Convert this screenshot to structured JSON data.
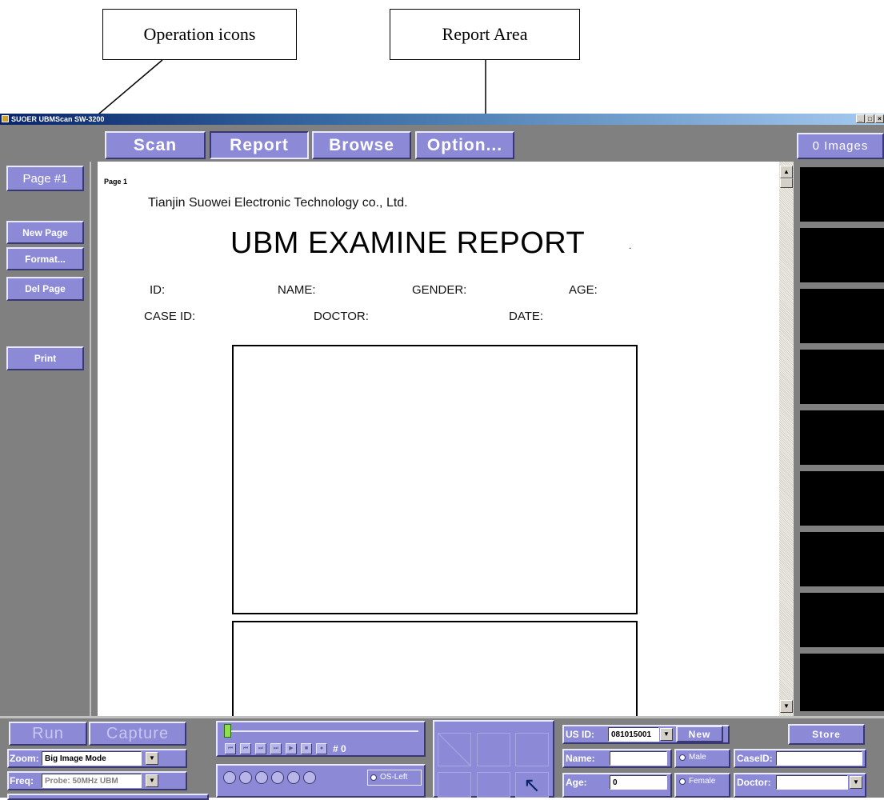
{
  "callouts": {
    "operation_icons": "Operation icons",
    "report_area": "Report Area"
  },
  "window": {
    "title": "SUOER UBMScan SW-3200",
    "min": "_",
    "max": "□",
    "close": "×"
  },
  "toolbar": {
    "tabs": [
      "Scan",
      "Report",
      "Browse",
      "Option..."
    ],
    "active_tab": "Report",
    "images_count": "0 Images"
  },
  "sidebar": {
    "page_label": "Page #1",
    "new_page": "New Page",
    "format": "Format...",
    "del_page": "Del Page",
    "print": "Print"
  },
  "report": {
    "page_tag": "Page 1",
    "company": "Tianjin Suowei Electronic Technology co., Ltd.",
    "title": "UBM EXAMINE REPORT",
    "title_dot": ".",
    "fields_row1": [
      "ID:",
      "NAME:",
      "GENDER:",
      "AGE:"
    ],
    "fields_row2": [
      "CASE ID:",
      "DOCTOR:",
      "DATE:"
    ]
  },
  "scroll": {
    "up": "▲",
    "down": "▼"
  },
  "bottom": {
    "run": "Run",
    "capture": "Capture",
    "zoom_label": "Zoom:",
    "zoom_value": "Big Image Mode",
    "freq_label": "Freq:",
    "freq_value": "Probe: 50MHz UBM",
    "frame_counter": "# 0",
    "playback_icons": [
      "⏮",
      "⏮",
      "⏭",
      "⏭",
      "▶",
      "■",
      "●"
    ],
    "eye_option": "OS-Left",
    "us_id_label": "US ID:",
    "us_id_value": "081015001",
    "new_button": "New",
    "store_button": "Store",
    "name_label": "Name:",
    "name_value": "",
    "male": "Male",
    "female": "Female",
    "caseid_label": "CaseID:",
    "caseid_value": "",
    "age_label": "Age:",
    "age_value": "0",
    "doctor_label": "Doctor:",
    "doctor_value": ""
  },
  "colors": {
    "button_purple": "#8c8ad6",
    "chrome_gray": "#808080",
    "thumb_black": "#000000"
  }
}
